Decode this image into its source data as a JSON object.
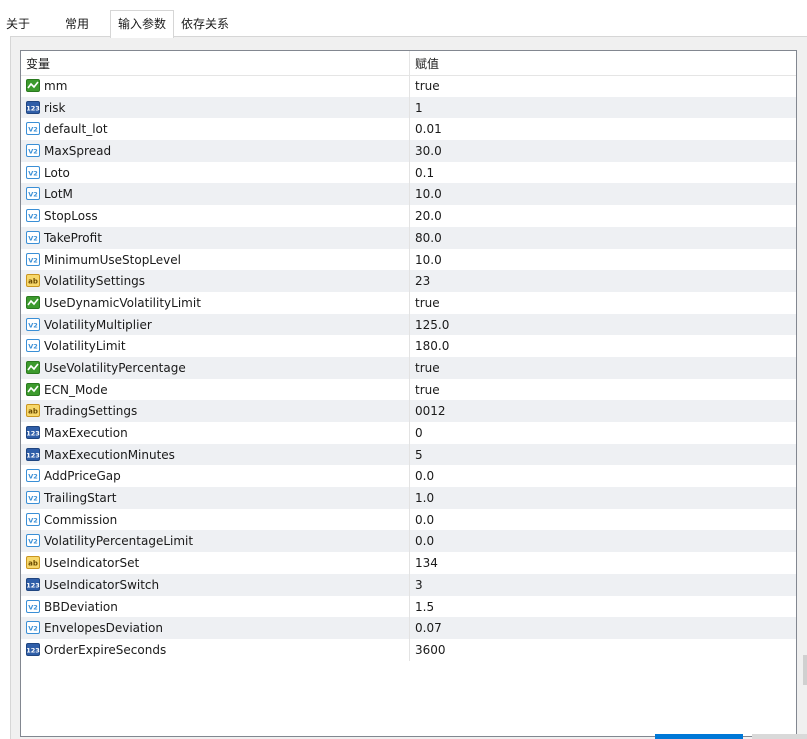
{
  "tabs": [
    {
      "label": "关于",
      "active": false
    },
    {
      "label": "常用",
      "active": false
    },
    {
      "label": "输入参数",
      "active": true
    },
    {
      "label": "依存关系",
      "active": false
    }
  ],
  "table": {
    "columns": [
      "变量",
      "赋值"
    ],
    "rows": [
      {
        "icon": "bool",
        "name": "mm",
        "value": "true"
      },
      {
        "icon": "int",
        "name": "risk",
        "value": "1"
      },
      {
        "icon": "double",
        "name": "default_lot",
        "value": "0.01"
      },
      {
        "icon": "double",
        "name": "MaxSpread",
        "value": "30.0"
      },
      {
        "icon": "double",
        "name": "Loto",
        "value": "0.1"
      },
      {
        "icon": "double",
        "name": "LotM",
        "value": "10.0"
      },
      {
        "icon": "double",
        "name": "StopLoss",
        "value": "20.0"
      },
      {
        "icon": "double",
        "name": "TakeProfit",
        "value": "80.0"
      },
      {
        "icon": "double",
        "name": "MinimumUseStopLevel",
        "value": "10.0"
      },
      {
        "icon": "string",
        "name": "VolatilitySettings",
        "value": "23"
      },
      {
        "icon": "bool",
        "name": "UseDynamicVolatilityLimit",
        "value": "true"
      },
      {
        "icon": "double",
        "name": "VolatilityMultiplier",
        "value": "125.0"
      },
      {
        "icon": "double",
        "name": "VolatilityLimit",
        "value": "180.0"
      },
      {
        "icon": "bool",
        "name": "UseVolatilityPercentage",
        "value": "true"
      },
      {
        "icon": "bool",
        "name": "ECN_Mode",
        "value": "true"
      },
      {
        "icon": "string",
        "name": "TradingSettings",
        "value": "0012"
      },
      {
        "icon": "int",
        "name": "MaxExecution",
        "value": "0"
      },
      {
        "icon": "int",
        "name": "MaxExecutionMinutes",
        "value": "5"
      },
      {
        "icon": "double",
        "name": "AddPriceGap",
        "value": "0.0"
      },
      {
        "icon": "double",
        "name": "TrailingStart",
        "value": "1.0"
      },
      {
        "icon": "double",
        "name": "Commission",
        "value": "0.0"
      },
      {
        "icon": "double",
        "name": "VolatilityPercentageLimit",
        "value": "0.0"
      },
      {
        "icon": "string",
        "name": "UseIndicatorSet",
        "value": "134"
      },
      {
        "icon": "int",
        "name": "UseIndicatorSwitch",
        "value": "3"
      },
      {
        "icon": "double",
        "name": "BBDeviation",
        "value": "1.5"
      },
      {
        "icon": "double",
        "name": "EnvelopesDeviation",
        "value": "0.07"
      },
      {
        "icon": "int",
        "name": "OrderExpireSeconds",
        "value": "3600"
      }
    ]
  },
  "colors": {
    "row_alt": "#eef0f3",
    "bool_icon": "#3c9a2d",
    "int_icon": "#2f5ea8",
    "double_icon": "#3a8fd6",
    "string_icon": "#c9951f"
  }
}
